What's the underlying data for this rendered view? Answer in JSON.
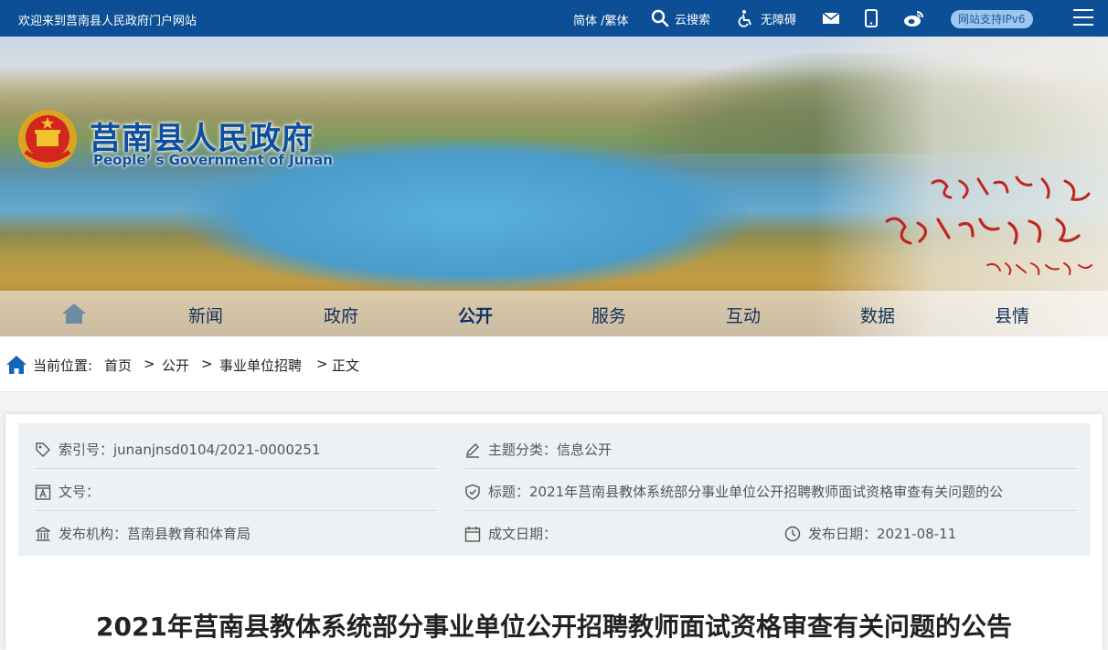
{
  "topbar": {
    "welcome": "欢迎来到莒南县人民政府门户网站",
    "lang": "简体 /繁体",
    "search": "云搜索",
    "accessibility": "无障碍",
    "ipv6": "网站支持IPv6"
  },
  "banner": {
    "title": "莒南县人民政府",
    "subtitle": "People’ s Government of Junan"
  },
  "nav": {
    "items": [
      "新闻",
      "政府",
      "公开",
      "服务",
      "互动",
      "数据",
      "县情"
    ],
    "active": "公开"
  },
  "breadcrumb": {
    "label": "当前位置:",
    "items": [
      "首页",
      "公开",
      "事业单位招聘",
      "正文"
    ],
    "sep": ">"
  },
  "meta": {
    "index_no": "索引号：junanjnsd0104/2021-0000251",
    "topic": "主题分类：信息公开",
    "doc_no": "文号：",
    "title": "标题：2021年莒南县教体系统部分事业单位公开招聘教师面试资格审查有关问题的公",
    "publisher": "发布机构：莒南县教育和体育局",
    "created": "成文日期：",
    "published": "发布日期：2021-08-11"
  },
  "article": {
    "title": "2021年莒南县教体系统部分事业单位公开招聘教师面试资格审查有关问题的公告"
  },
  "colors": {
    "primary": "#0d4f96",
    "meta_bg": "#eef1f4"
  }
}
